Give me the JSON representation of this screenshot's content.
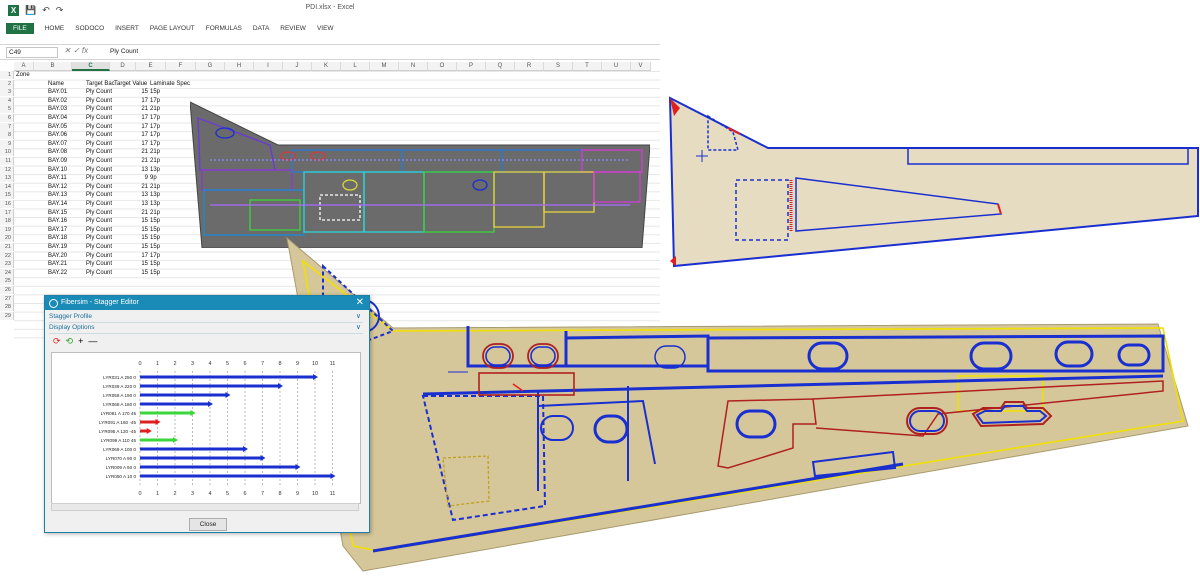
{
  "excel": {
    "window_title": "PDI.xlsx - Excel",
    "tabs": [
      "FILE",
      "HOME",
      "SODOCO",
      "INSERT",
      "PAGE LAYOUT",
      "FORMULAS",
      "DATA",
      "REVIEW",
      "VIEW"
    ],
    "name_box": "C49",
    "formula_content": "Ply Count",
    "columns": [
      "A",
      "B",
      "C",
      "D",
      "E",
      "F",
      "G",
      "H",
      "I",
      "J",
      "K",
      "L",
      "M",
      "N",
      "O",
      "P",
      "Q",
      "R",
      "S",
      "T",
      "U",
      "V"
    ],
    "selected_column": "C",
    "zone_label": "Zone",
    "headers": [
      "Name",
      "Target Bac",
      "Target Value",
      "Laminate Spec"
    ],
    "rows": [
      [
        "BAY.01",
        "Ply Count",
        "15",
        "15p"
      ],
      [
        "BAY.02",
        "Ply Count",
        "17",
        "17p"
      ],
      [
        "BAY.03",
        "Ply Count",
        "21",
        "21p"
      ],
      [
        "BAY.04",
        "Ply Count",
        "17",
        "17p"
      ],
      [
        "BAY.05",
        "Ply Count",
        "17",
        "17p"
      ],
      [
        "BAY.06",
        "Ply Count",
        "17",
        "17p"
      ],
      [
        "BAY.07",
        "Ply Count",
        "17",
        "17p"
      ],
      [
        "BAY.08",
        "Ply Count",
        "21",
        "21p"
      ],
      [
        "BAY.09",
        "Ply Count",
        "21",
        "21p"
      ],
      [
        "BAY.10",
        "Ply Count",
        "13",
        "13p"
      ],
      [
        "BAY.11",
        "Ply Count",
        "9",
        "9p"
      ],
      [
        "BAY.12",
        "Ply Count",
        "21",
        "21p"
      ],
      [
        "BAY.13",
        "Ply Count",
        "13",
        "13p"
      ],
      [
        "BAY.14",
        "Ply Count",
        "13",
        "13p"
      ],
      [
        "BAY.15",
        "Ply Count",
        "21",
        "21p"
      ],
      [
        "BAY.16",
        "Ply Count",
        "15",
        "15p"
      ],
      [
        "BAY.17",
        "Ply Count",
        "15",
        "15p"
      ],
      [
        "BAY.18",
        "Ply Count",
        "15",
        "15p"
      ],
      [
        "BAY.19",
        "Ply Count",
        "15",
        "15p"
      ],
      [
        "BAY.20",
        "Ply Count",
        "17",
        "17p"
      ],
      [
        "BAY.21",
        "Ply Count",
        "15",
        "15p"
      ],
      [
        "BAY.22",
        "Ply Count",
        "15",
        "15p"
      ]
    ],
    "row_numbers": [
      "1",
      "2",
      "3",
      "4",
      "5",
      "6",
      "7",
      "8",
      "9",
      "10",
      "11",
      "12",
      "13",
      "14",
      "15",
      "16",
      "17",
      "18",
      "19",
      "20",
      "21",
      "22",
      "23",
      "24",
      "25",
      "26",
      "27",
      "28",
      "29"
    ]
  },
  "dialog": {
    "title": "Fibersim - Stagger Editor",
    "section_profile": "Stagger Profile",
    "section_display": "Display Options",
    "close_label": "Close",
    "axis_ticks": [
      "0",
      "1",
      "2",
      "3",
      "4",
      "5",
      "6",
      "7",
      "8",
      "9",
      "10",
      "11"
    ],
    "plies": [
      {
        "name": "LYR031 A 250 0",
        "value": 10,
        "color": "#1a2fd0"
      },
      {
        "name": "LYR039 A 220 0",
        "value": 8,
        "color": "#1a2fd0"
      },
      {
        "name": "LYR058 A 190 0",
        "value": 5,
        "color": "#1a2fd0"
      },
      {
        "name": "LYR068 A 180 0",
        "value": 4,
        "color": "#1a2fd0"
      },
      {
        "name": "LYR081 A 170 45",
        "value": 3,
        "color": "#3ad63a"
      },
      {
        "name": "LYR091 A 160 -45",
        "value": 1,
        "color": "#e02020"
      },
      {
        "name": "LYR095 A 120 -45",
        "value": 0.5,
        "color": "#e02020"
      },
      {
        "name": "LYR099 A 110 45",
        "value": 2,
        "color": "#3ad63a"
      },
      {
        "name": "LYR069 A 100 0",
        "value": 6,
        "color": "#1a2fd0"
      },
      {
        "name": "LYR070 A 90 0",
        "value": 7,
        "color": "#1a2fd0"
      },
      {
        "name": "LYR009 A 60 0",
        "value": 9,
        "color": "#1a2fd0"
      },
      {
        "name": "LYR050 A 10 0",
        "value": 11,
        "color": "#1a2fd0"
      }
    ]
  }
}
